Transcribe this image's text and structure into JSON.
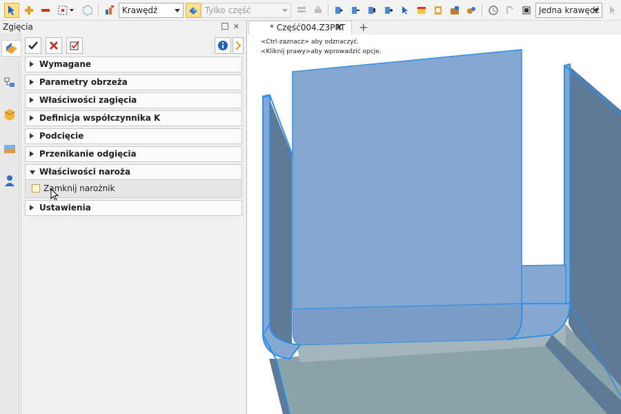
{
  "toolbar": {
    "filter_combo": "Krawędź",
    "scope_combo": "Tylko część",
    "pick_combo": "Jedna krawędź"
  },
  "panel": {
    "title": "Zgięcia",
    "sections": [
      {
        "label": "Wymagane",
        "open": false
      },
      {
        "label": "Parametry obrzeża",
        "open": false
      },
      {
        "label": "Właściwości zagięcia",
        "open": false
      },
      {
        "label": "Definicja współczynnika K",
        "open": false
      },
      {
        "label": "Podcięcie",
        "open": false
      },
      {
        "label": "Przenikanie odgięcia",
        "open": false
      },
      {
        "label": "Właściwości naroża",
        "open": true
      },
      {
        "label": "Ustawienia",
        "open": false
      }
    ],
    "close_corner_label": "Zamknij narożnik"
  },
  "viewport": {
    "tab_label": "* Część004.Z3PRT",
    "hint_ctrl": "<Ctrl-zaznacz> aby odznaczyć.",
    "hint_right": "<Kliknij prawy>aby wprowadzić opcje."
  },
  "colors": {
    "accent": "#2f8ee8",
    "part_face": "#84a8d2",
    "part_side": "#5e7a96",
    "part_floor": "#8aa3a8"
  }
}
